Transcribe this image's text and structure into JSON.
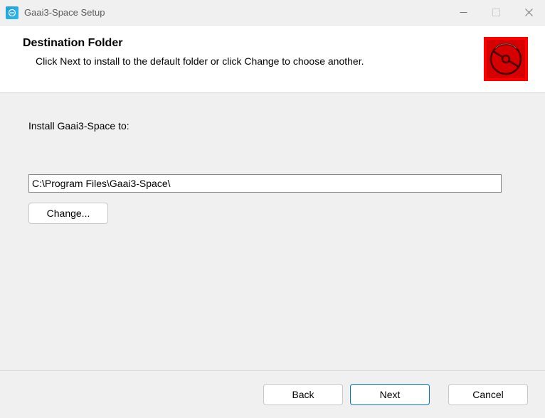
{
  "titlebar": {
    "title": "Gaai3-Space Setup"
  },
  "header": {
    "title": "Destination Folder",
    "subtitle": "Click Next to install to the default folder or click Change to choose another."
  },
  "content": {
    "install_label": "Install Gaai3-Space to:",
    "path_value": "C:\\Program Files\\Gaai3-Space\\",
    "change_label": "Change..."
  },
  "footer": {
    "back_label": "Back",
    "next_label": "Next",
    "cancel_label": "Cancel"
  }
}
